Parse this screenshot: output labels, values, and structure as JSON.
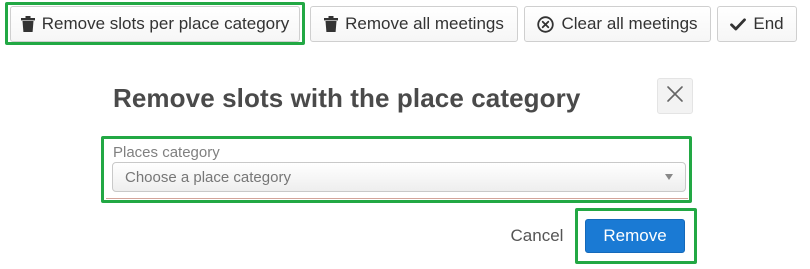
{
  "toolbar": {
    "buttons": [
      {
        "label": "Remove slots per place category",
        "icon": "trash-icon"
      },
      {
        "label": "Remove all meetings",
        "icon": "trash-icon"
      },
      {
        "label": "Clear all meetings",
        "icon": "circle-x-icon"
      },
      {
        "label": "End",
        "icon": "check-icon"
      }
    ]
  },
  "dialog": {
    "title": "Remove slots with the place category",
    "close_icon": "close-icon",
    "field_label": "Places category",
    "select_placeholder": "Choose a place category",
    "cancel_label": "Cancel",
    "remove_label": "Remove"
  },
  "colors": {
    "highlight": "#22a844",
    "primary": "#1a7ad4",
    "title": "#4a4a4a"
  }
}
